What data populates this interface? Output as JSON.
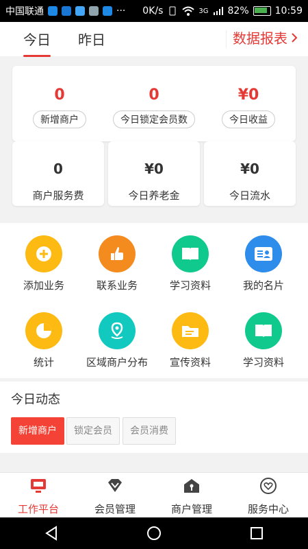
{
  "statusbar": {
    "carrier": "中国联通",
    "network_speed": "0K/s",
    "signal_label": "3G",
    "battery_percent": "82%",
    "time": "10:59"
  },
  "topbar": {
    "tab_today": "今日",
    "tab_yesterday": "昨日",
    "report_label": "数据报表"
  },
  "metrics_top": [
    {
      "value": "0",
      "label": "新增商户"
    },
    {
      "value": "0",
      "label": "今日锁定会员数"
    },
    {
      "value": "¥0",
      "label": "今日收益"
    }
  ],
  "metrics_row2": [
    {
      "value": "0",
      "label": "商户服务费"
    },
    {
      "value": "¥0",
      "label": "今日养老金"
    },
    {
      "value": "¥0",
      "label": "今日流水"
    }
  ],
  "features": [
    {
      "label": "添加业务",
      "icon": "plus-icon",
      "color": "#FDBA12"
    },
    {
      "label": "联系业务",
      "icon": "thumbs-up-icon",
      "color": "#F48B1F"
    },
    {
      "label": "学习资料",
      "icon": "book-icon",
      "color": "#10C98C"
    },
    {
      "label": "我的名片",
      "icon": "id-card-icon",
      "color": "#2E8DEB"
    },
    {
      "label": "统计",
      "icon": "pie-chart-icon",
      "color": "#FDBA12"
    },
    {
      "label": "区域商户分布",
      "icon": "map-pin-icon",
      "color": "#12C9C0"
    },
    {
      "label": "宣传资料",
      "icon": "folder-icon",
      "color": "#FDBA12"
    },
    {
      "label": "学习资料",
      "icon": "book-icon",
      "color": "#10C98C"
    }
  ],
  "dynamics": {
    "title": "今日动态",
    "chips": [
      "新增商户",
      "锁定会员",
      "会员消费"
    ]
  },
  "bottom_nav": [
    {
      "label": "工作平台",
      "icon": "monitor-icon"
    },
    {
      "label": "会员管理",
      "icon": "diamond-icon"
    },
    {
      "label": "商户管理",
      "icon": "shop-icon"
    },
    {
      "label": "服务中心",
      "icon": "heart-icon"
    }
  ],
  "colors": {
    "accent": "#E53935"
  }
}
